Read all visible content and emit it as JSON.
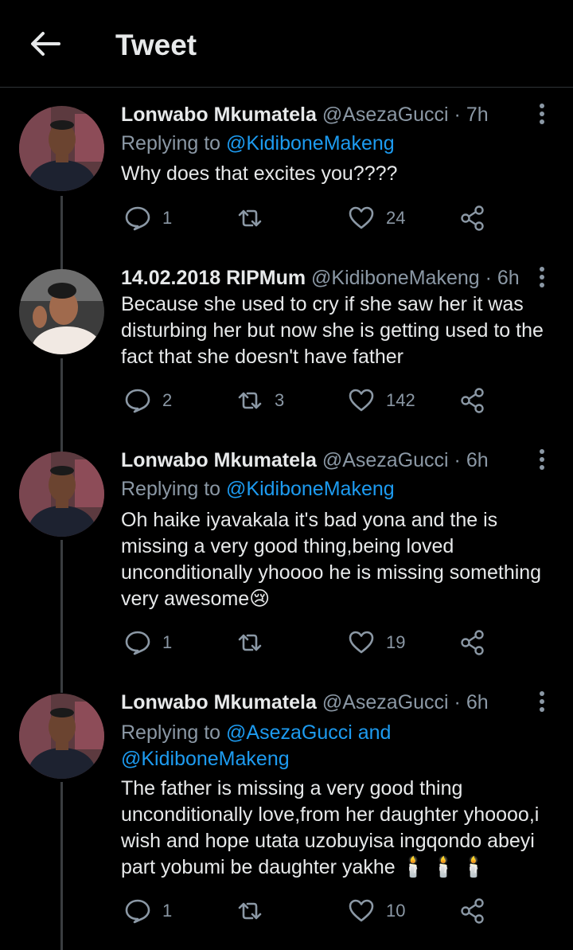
{
  "header": {
    "title": "Tweet"
  },
  "tweets": [
    {
      "name": "Lonwabo Mkumatela",
      "handle": "@AsezaGucci",
      "time": "7h",
      "replying_prefix": "Replying to",
      "replying_to": "@KidiboneMakeng",
      "body": "Why does that excites you????",
      "replies": "1",
      "retweets": "",
      "likes": "24"
    },
    {
      "name": "14.02.2018 RIPMum",
      "handle": "@KidiboneMakeng",
      "time": "6h",
      "replying_prefix": "",
      "replying_to": "",
      "body": "Because she used to cry if she saw her it was disturbing her but now she is getting used to the fact that she doesn't have father",
      "replies": "2",
      "retweets": "3",
      "likes": "142"
    },
    {
      "name": "Lonwabo Mkumatela",
      "handle": "@AsezaGucci",
      "time": "6h",
      "replying_prefix": "Replying to",
      "replying_to": "@KidiboneMakeng",
      "body": "Oh haike iyavakala it's bad yona and the is missing a very good thing,being loved unconditionally yhoooo he is missing something very awesome😢",
      "replies": "1",
      "retweets": "",
      "likes": "19"
    },
    {
      "name": "Lonwabo Mkumatela",
      "handle": "@AsezaGucci",
      "time": "6h",
      "replying_prefix": "Replying to",
      "replying_to": "@AsezaGucci and @KidiboneMakeng",
      "body": "The father is missing a very good thing unconditionally love,from her daughter yhoooo,i wish and hope utata uzobuyisa ingqondo abeyi part yobumi be daughter yakhe 🕯️ 🕯️ 🕯️",
      "replies": "1",
      "retweets": "",
      "likes": "10"
    }
  ],
  "colors": {
    "background": "#000000",
    "text": "#e7e9ea",
    "muted": "#8b98a5",
    "link": "#1d9bf0"
  }
}
